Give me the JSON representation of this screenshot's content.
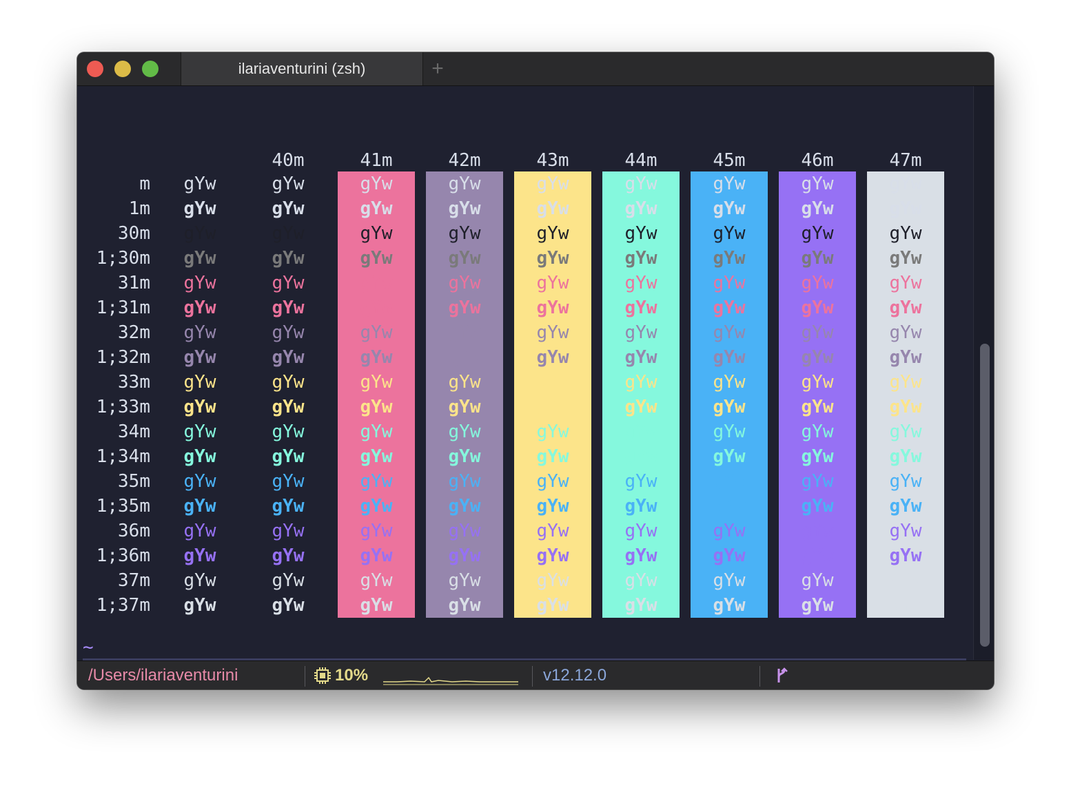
{
  "window": {
    "tab_title": "ilariaventurini (zsh)",
    "new_tab_symbol": "+",
    "controls": [
      "close",
      "minimize",
      "zoom"
    ]
  },
  "colortest": {
    "sample_text": "gYw",
    "background_headers": [
      "",
      "",
      "40m",
      "41m",
      "42m",
      "43m",
      "44m",
      "45m",
      "46m",
      "47m"
    ],
    "background_colors": [
      "#1f2130",
      "#1f2130",
      "#1f2130",
      "#ec739d",
      "#9686ad",
      "#fce48a",
      "#85f8dd",
      "#4ab2f6",
      "#9671f4",
      "#d9dfe6"
    ],
    "row_labels": [
      "m",
      "1m",
      "30m",
      "1;30m",
      "31m",
      "1;31m",
      "32m",
      "1;32m",
      "33m",
      "1;33m",
      "34m",
      "1;34m",
      "35m",
      "1;35m",
      "36m",
      "1;36m",
      "37m",
      "1;37m"
    ],
    "row_colors": [
      "#d8dee9",
      "#d8dee9",
      "#1e1f29",
      "#7a7a7a",
      "#ec739d",
      "#ec739d",
      "#9686ad",
      "#9686ad",
      "#fce48a",
      "#fce48a",
      "#85f8dd",
      "#85f8dd",
      "#4ab2f6",
      "#4ab2f6",
      "#9671f4",
      "#9671f4",
      "#d9dfe6",
      "#d9dfe6"
    ],
    "row_bold": [
      false,
      true,
      false,
      true,
      false,
      true,
      false,
      true,
      false,
      true,
      false,
      true,
      false,
      true,
      false,
      true,
      false,
      true
    ]
  },
  "prompt": {
    "symbol": "~"
  },
  "statusbar": {
    "path": "/Users/ilariaventurini",
    "cpu": "10%",
    "node_version": "v12.12.0",
    "colors": {
      "path": "#e78aa8",
      "cpu": "#e3d98a",
      "node": "#8aa6d9",
      "git": "#c792ea"
    }
  }
}
